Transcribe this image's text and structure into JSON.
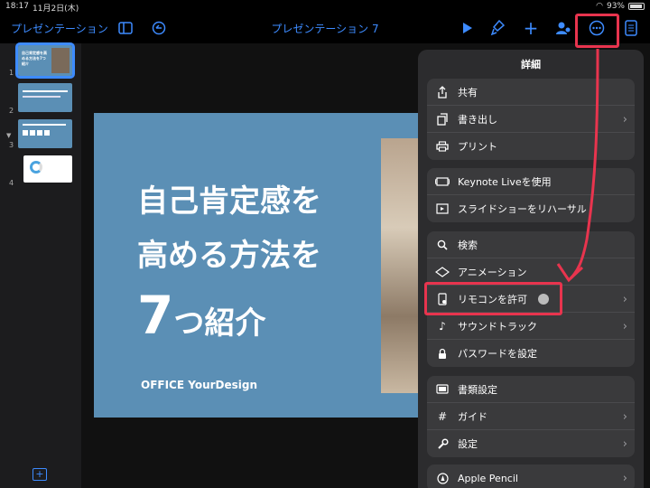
{
  "status_bar": {
    "time": "18:17",
    "date": "11月2日(木)",
    "battery": "93%"
  },
  "toolbar": {
    "back_label": "プレゼンテーション",
    "doc_title": "プレゼンテーション 7"
  },
  "slides": {
    "numbers": [
      "1",
      "2",
      "3",
      "4"
    ],
    "thumb1_text": "自己肯定感を高める方法を7つ紹介"
  },
  "slide": {
    "line1": "自己肯定感を",
    "line2": "高める方法を",
    "line3_num": "7",
    "line3_rest": "つ紹介",
    "brand": "OFFICE YourDesign"
  },
  "menu": {
    "title": "詳細",
    "groups": [
      [
        {
          "label": "共有",
          "icon": "share-icon"
        },
        {
          "label": "書き出し",
          "icon": "export-icon",
          "chevron": true
        },
        {
          "label": "プリント",
          "icon": "printer-icon"
        }
      ],
      [
        {
          "label": "Keynote Liveを使用",
          "icon": "live-icon"
        },
        {
          "label": "スライドショーをリハーサル",
          "icon": "rehearse-icon"
        }
      ],
      [
        {
          "label": "検索",
          "icon": "search-icon"
        },
        {
          "label": "アニメーション",
          "icon": "animation-icon"
        },
        {
          "label": "リモコンを許可",
          "icon": "remote-icon",
          "chevron": true,
          "toggle": true
        },
        {
          "label": "サウンドトラック",
          "icon": "music-note-icon",
          "chevron": true
        },
        {
          "label": "パスワードを設定",
          "icon": "lock-icon"
        }
      ],
      [
        {
          "label": "書類設定",
          "icon": "document-icon"
        },
        {
          "label": "ガイド",
          "icon": "guide-icon",
          "chevron": true
        },
        {
          "label": "設定",
          "icon": "wrench-icon",
          "chevron": true
        }
      ],
      [
        {
          "label": "Apple Pencil",
          "icon": "pencil-icon",
          "chevron": true
        }
      ]
    ]
  }
}
